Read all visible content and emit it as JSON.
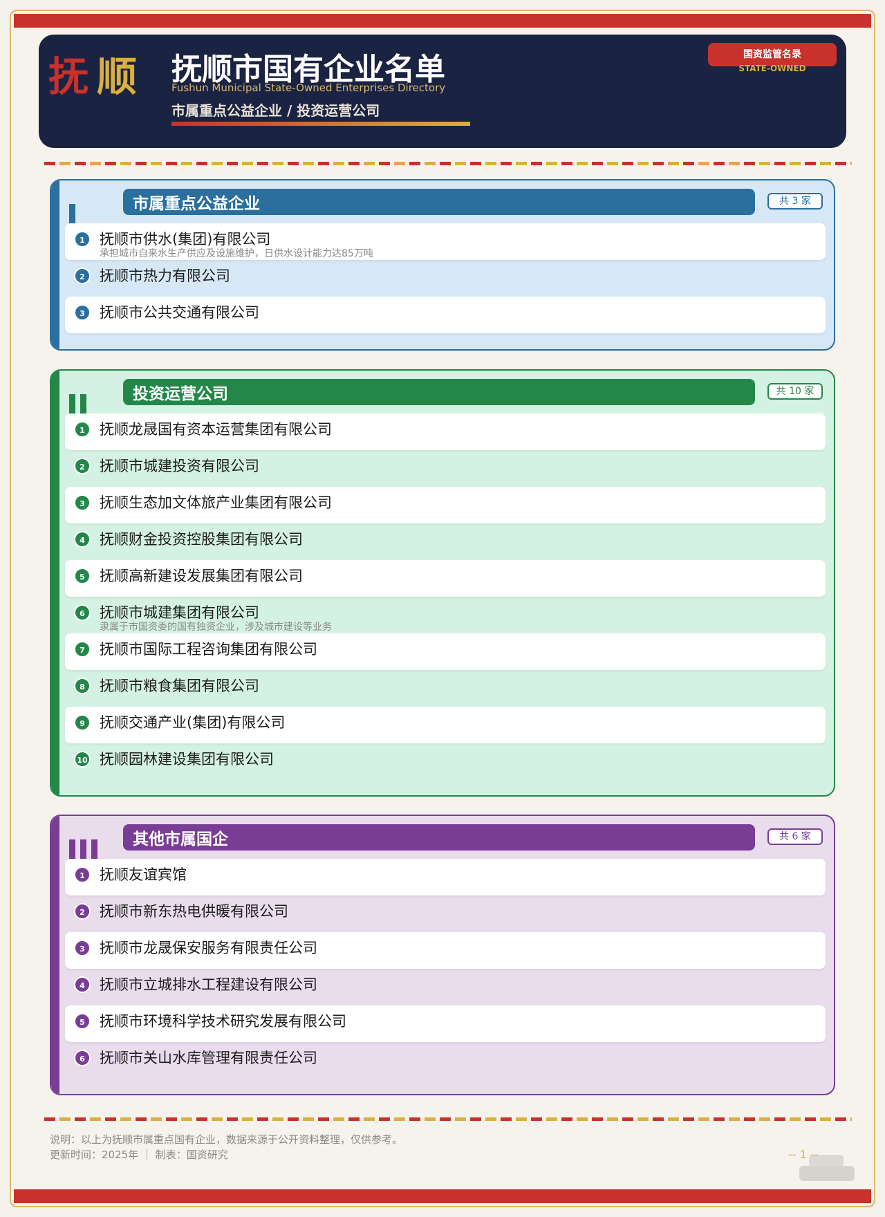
{
  "header": {
    "logo_char1": "抚",
    "logo_char2": "顺",
    "title": "抚顺市国有企业名单",
    "subtitle_en": "Fushun Municipal State-Owned Enterprises Directory",
    "subtitle_cn": "市属重点公益企业 / 投资运营公司",
    "stamp": "国资监管名录",
    "stamp_en": "STATE-OWNED"
  },
  "sections": [
    {
      "title": "市属重点公益企业",
      "count": "共 3 家",
      "color": "#2a6f9e",
      "items": [
        {
          "num": "1",
          "name": "抚顺市供水(集团)有限公司",
          "note": "承担城市自来水生产供应及设施维护，日供水设计能力达85万吨"
        },
        {
          "num": "2",
          "name": "抚顺市热力有限公司"
        },
        {
          "num": "3",
          "name": "抚顺市公共交通有限公司"
        }
      ]
    },
    {
      "title": "投资运营公司",
      "count": "共 10 家",
      "color": "#23874a",
      "items": [
        {
          "num": "1",
          "name": "抚顺龙晟国有资本运营集团有限公司"
        },
        {
          "num": "2",
          "name": "抚顺市城建投资有限公司"
        },
        {
          "num": "3",
          "name": "抚顺生态加文体旅产业集团有限公司"
        },
        {
          "num": "4",
          "name": "抚顺财金投资控股集团有限公司"
        },
        {
          "num": "5",
          "name": "抚顺高新建设发展集团有限公司"
        },
        {
          "num": "6",
          "name": "抚顺市城建集团有限公司",
          "note": "隶属于市国资委的国有独资企业，涉及城市建设等业务"
        },
        {
          "num": "7",
          "name": "抚顺市国际工程咨询集团有限公司"
        },
        {
          "num": "8",
          "name": "抚顺市粮食集团有限公司"
        },
        {
          "num": "9",
          "name": "抚顺交通产业(集团)有限公司"
        },
        {
          "num": "10",
          "name": "抚顺园林建设集团有限公司"
        }
      ]
    },
    {
      "title": "其他市属国企",
      "count": "共 6 家",
      "color": "#7a3d96",
      "items": [
        {
          "num": "1",
          "name": "抚顺友谊宾馆"
        },
        {
          "num": "2",
          "name": "抚顺市新东热电供暖有限公司"
        },
        {
          "num": "3",
          "name": "抚顺市龙晟保安服务有限责任公司"
        },
        {
          "num": "4",
          "name": "抚顺市立城排水工程建设有限公司"
        },
        {
          "num": "5",
          "name": "抚顺市环境科学技术研究发展有限公司"
        },
        {
          "num": "6",
          "name": "抚顺市关山水库管理有限责任公司"
        }
      ]
    }
  ],
  "footer": {
    "note": "说明：以上为抚顺市属重点国有企业，数据来源于公开资料整理，仅供参考。",
    "meta": "更新时间：2025年 ｜ 制表：国资研究",
    "page": "-- 1 --"
  }
}
